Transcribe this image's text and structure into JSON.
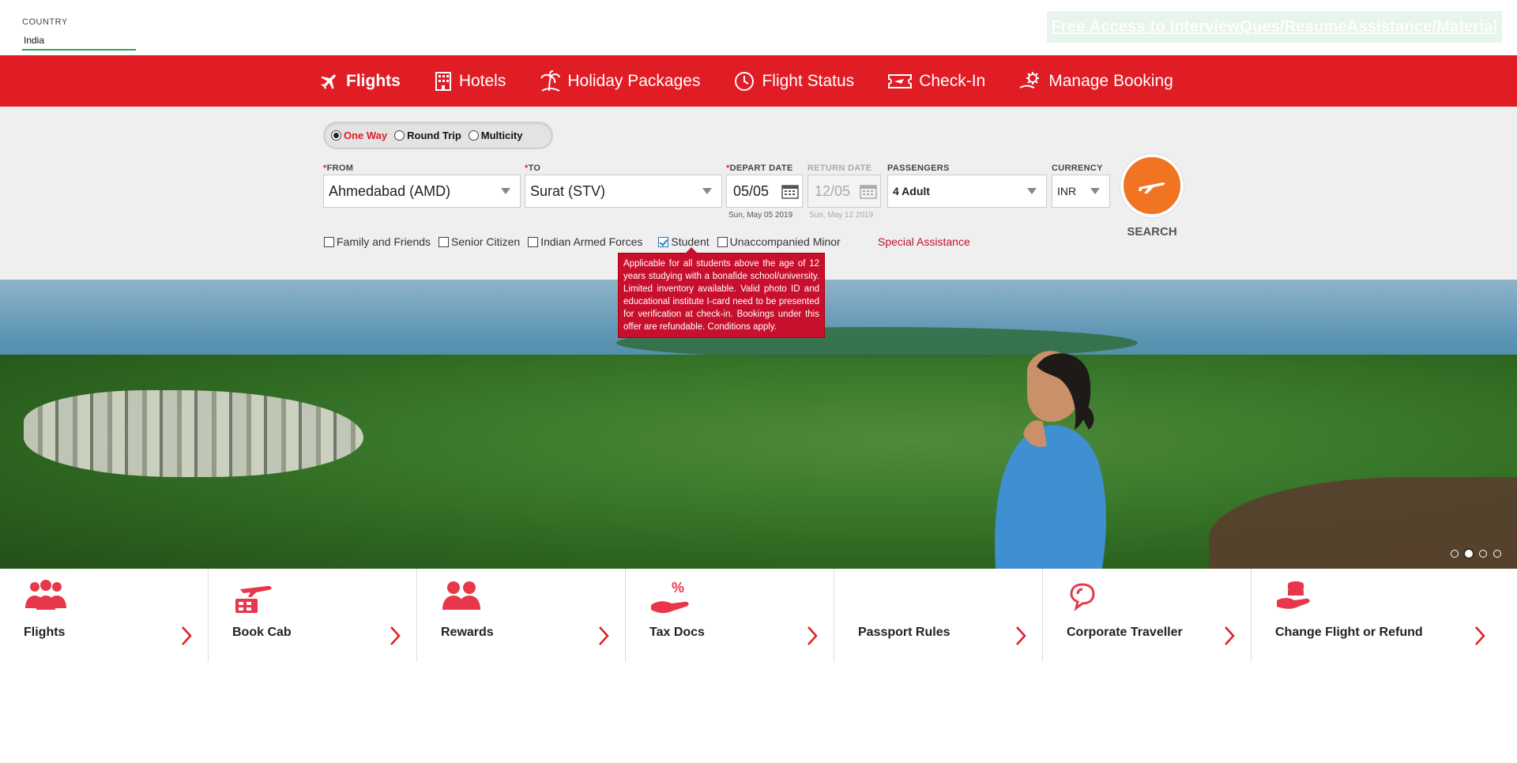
{
  "country": {
    "label": "COUNTRY",
    "value": "India"
  },
  "promo": {
    "text": "Free Access to InterviewQues/ResumeAssistance/Material"
  },
  "nav": {
    "items": [
      {
        "label": "Flights",
        "icon": "plane-icon"
      },
      {
        "label": "Hotels",
        "icon": "hotel-icon"
      },
      {
        "label": "Holiday Packages",
        "icon": "palm-tree-icon"
      },
      {
        "label": "Flight Status",
        "icon": "clock-icon"
      },
      {
        "label": "Check-In",
        "icon": "ticket-icon"
      },
      {
        "label": "Manage Booking",
        "icon": "gear-hand-icon"
      }
    ]
  },
  "trip": {
    "one_way": "One Way",
    "round_trip": "Round Trip",
    "multicity": "Multicity",
    "selected": "One Way"
  },
  "form": {
    "from_label": "FROM",
    "from_value": "Ahmedabad (AMD)",
    "to_label": "TO",
    "to_value": "Surat (STV)",
    "depart_label": "DEPART DATE",
    "depart_value": "05/05",
    "depart_sub": "Sun, May 05 2019",
    "return_label": "RETURN DATE",
    "return_value": "12/05",
    "return_sub": "Sun, May 12 2019",
    "passengers_label": "PASSENGERS",
    "passengers_value": "4 Adult",
    "currency_label": "CURRENCY",
    "currency_value": "INR",
    "search_label": "SEARCH"
  },
  "checkboxes": [
    {
      "label": "Family and Friends",
      "checked": false
    },
    {
      "label": "Senior Citizen",
      "checked": false
    },
    {
      "label": "Indian Armed Forces",
      "checked": false
    },
    {
      "label": "Student",
      "checked": true
    },
    {
      "label": "Unaccompanied Minor",
      "checked": false
    }
  ],
  "special_assistance": "Special Assistance",
  "tooltip": "Applicable for all students above the age of 12 years studying with a bonafide school/university. Limited inventory available. Valid photo ID and educational institute I-card need to be presented for verification at check-in. Bookings under this offer are refundable. Conditions apply.",
  "carousel": {
    "count": 4,
    "active": 2
  },
  "tiles": [
    {
      "label": "Flights",
      "icon": "group-icon"
    },
    {
      "label": "Book Cab",
      "icon": "cab-plane-icon"
    },
    {
      "label": "Rewards",
      "icon": "people-icon"
    },
    {
      "label": "Tax Docs",
      "icon": "percent-hand-icon"
    },
    {
      "label": "Passport Rules",
      "icon": ""
    },
    {
      "label": "Corporate Traveller",
      "icon": "chat-icon"
    },
    {
      "label": "Change Flight or Refund",
      "icon": "coins-hand-icon"
    }
  ],
  "colors": {
    "brand_red": "#e01c25",
    "search_orange": "#f07422",
    "tooltip_red": "#c8102e"
  }
}
